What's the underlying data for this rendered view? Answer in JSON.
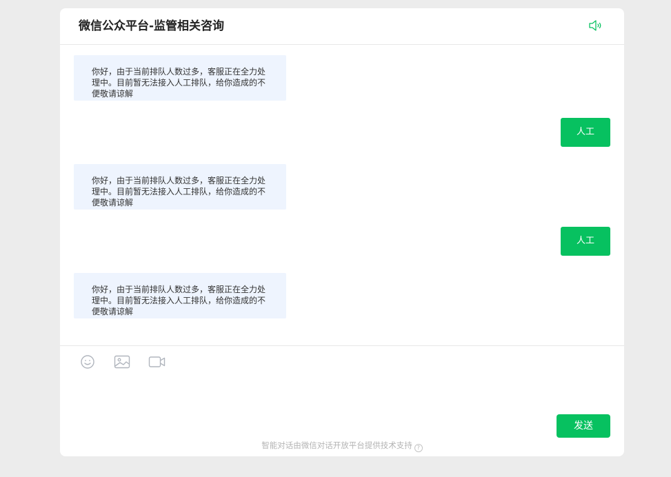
{
  "header": {
    "title": "微信公众平台-监管相关咨询",
    "speaker_icon": "speaker-icon"
  },
  "messages": [
    {
      "from": "bot",
      "text": "你好，由于当前排队人数过多，客服正在全力处理中。目前暂无法接入人工排队，给你造成的不便敬请谅解"
    },
    {
      "from": "user",
      "text": "人工"
    },
    {
      "from": "bot",
      "text": "你好，由于当前排队人数过多，客服正在全力处理中。目前暂无法接入人工排队，给你造成的不便敬请谅解"
    },
    {
      "from": "user",
      "text": "人工"
    },
    {
      "from": "bot",
      "text": "你好，由于当前排队人数过多，客服正在全力处理中。目前暂无法接入人工排队，给你造成的不便敬请谅解"
    }
  ],
  "input": {
    "tools": [
      "emoji-icon",
      "image-icon",
      "video-icon"
    ],
    "send_label": "发送"
  },
  "footer": {
    "text": "智能对话由微信对话开放平台提供技术支持",
    "help_glyph": "?"
  },
  "colors": {
    "accent": "#07c160",
    "bot_bubble": "#eef4fe",
    "page_bg": "#ececec"
  }
}
